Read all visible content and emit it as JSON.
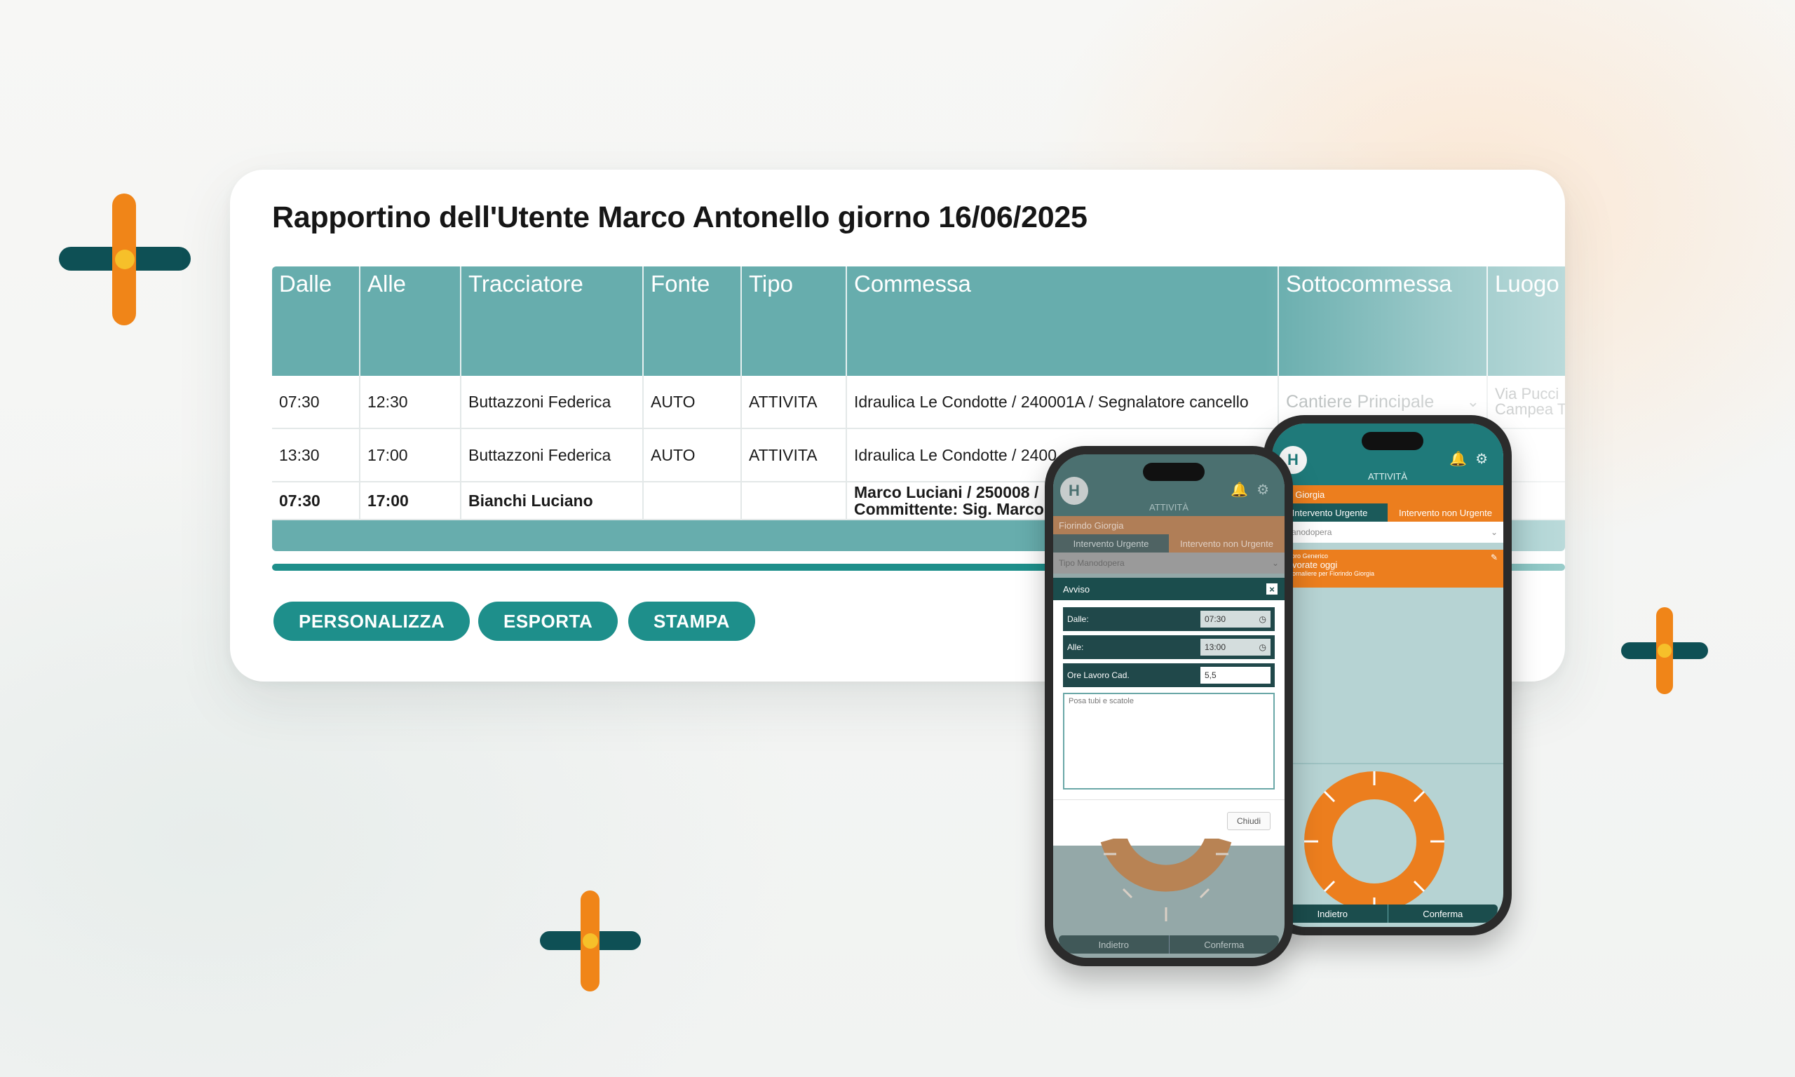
{
  "report": {
    "title": "Rapportino dell'Utente Marco Antonello giorno 16/06/2025",
    "columns": [
      "Dalle",
      "Alle",
      "Tracciatore",
      "Fonte",
      "Tipo",
      "Commessa",
      "Sottocommessa",
      "Luogo"
    ],
    "rows": [
      {
        "dalle": "07:30",
        "alle": "12:30",
        "tracciatore": "Buttazzoni Federica",
        "fonte": "AUTO",
        "tipo": "ATTIVITA",
        "commessa": "Idraulica Le Condotte / 240001A / Segnalatore cancello",
        "sottocommessa": "Cantiere Principale",
        "luogo_1": "Via Pucci",
        "luogo_2": "Campea T"
      },
      {
        "dalle": "13:30",
        "alle": "17:00",
        "tracciatore": "Buttazzoni Federica",
        "fonte": "AUTO",
        "tipo": "ATTIVITA",
        "commessa": "Idraulica Le Condotte / 2400"
      },
      {
        "dalle": "07:30",
        "alle": "17:00",
        "tracciatore": "Bianchi Luciano",
        "fonte": "",
        "tipo": "",
        "commessa_1": "Marco Luciani / 250008 / ",
        "commessa_2": "Committente: Sig. Marco"
      }
    ],
    "buttons": {
      "personalizza": "PERSONALIZZA",
      "esporta": "ESPORTA",
      "stampa": "STAMPA"
    }
  },
  "phone_back": {
    "logo": "H",
    "title": "ATTIVITÀ",
    "user": "ndo Giorgia",
    "tab_urgent": "Intervento Urgente",
    "tab_non_urgent": "Intervento non Urgente",
    "select": "o Manodopera",
    "card_line1": "- Lavoro Generico",
    "card_line2": "h lavorate oggi",
    "card_line3": "Ch giornaliere per Fiorindo Giorgia",
    "back": "Indietro",
    "confirm": "Conferma",
    "place_1": "a Pucci",
    "place_2": "ampea T"
  },
  "phone_front": {
    "logo": "H",
    "title": "ATTIVITÀ",
    "user": "Fiorindo Giorgia",
    "tab_urgent": "Intervento Urgente",
    "tab_non_urgent": "Intervento non Urgente",
    "select": "Tipo Manodopera",
    "modal": {
      "title": "Avviso",
      "close_x": "×",
      "dalle_label": "Dalle:",
      "dalle_value": "07:30",
      "alle_label": "Alle:",
      "alle_value": "13:00",
      "ore_label": "Ore Lavoro Cad.",
      "ore_value": "5,5",
      "note": "Posa tubi e scatole",
      "close_button": "Chiudi"
    },
    "back": "Indietro",
    "confirm": "Conferma"
  },
  "colors": {
    "teal_header": "#67adad",
    "teal_button": "#1e8f8b",
    "dark_teal": "#0e5055",
    "orange": "#f08518",
    "yellow": "#f6c02a"
  }
}
